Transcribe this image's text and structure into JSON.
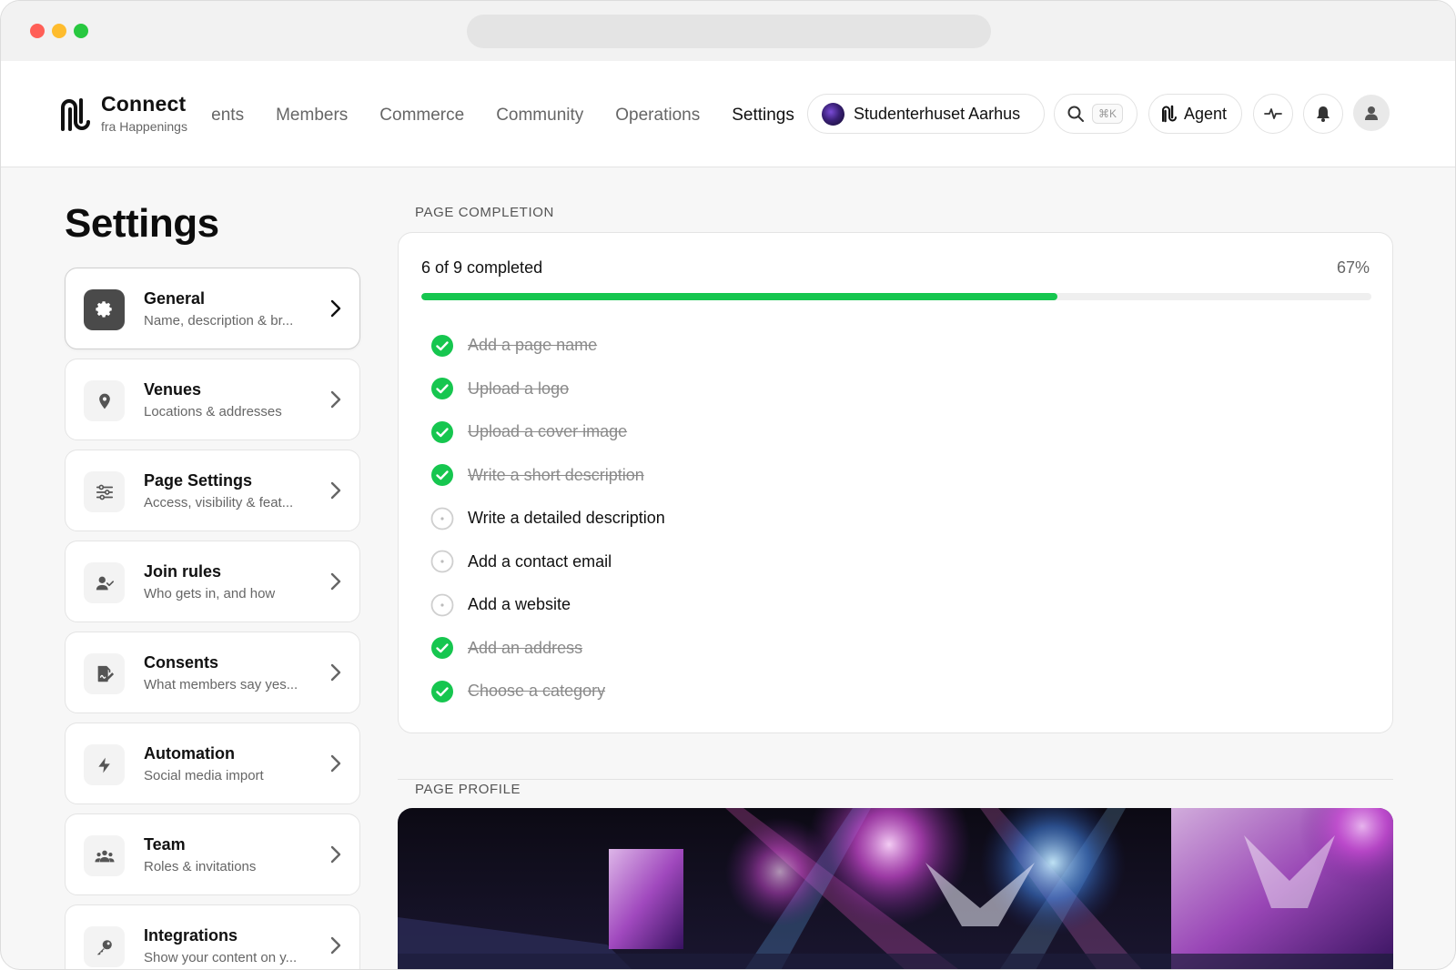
{
  "app": {
    "brand_title": "Connect",
    "brand_subtitle": "fra Happenings"
  },
  "nav": {
    "items": [
      {
        "label": "Events"
      },
      {
        "label": "Members"
      },
      {
        "label": "Commerce"
      },
      {
        "label": "Community"
      },
      {
        "label": "Operations"
      },
      {
        "label": "Settings"
      }
    ],
    "active_label": "Settings"
  },
  "header": {
    "org_name": "Studenterhuset Aarhus",
    "search_shortcut": "⌘K",
    "agent_label": "Agent",
    "icons": [
      "search-icon",
      "agent-logo-icon",
      "activity-icon",
      "bell-icon",
      "user-icon"
    ]
  },
  "settings": {
    "title": "Settings",
    "items": [
      {
        "title": "General",
        "subtitle": "Name, description & br...",
        "icon": "gear-icon",
        "active": true
      },
      {
        "title": "Venues",
        "subtitle": "Locations & addresses",
        "icon": "map-pin-icon"
      },
      {
        "title": "Page Settings",
        "subtitle": "Access, visibility & feat...",
        "icon": "sliders-icon"
      },
      {
        "title": "Join rules",
        "subtitle": "Who gets in, and how",
        "icon": "user-check-icon"
      },
      {
        "title": "Consents",
        "subtitle": "What members say yes...",
        "icon": "signature-icon"
      },
      {
        "title": "Automation",
        "subtitle": "Social media import",
        "icon": "bolt-icon"
      },
      {
        "title": "Team",
        "subtitle": "Roles & invitations",
        "icon": "team-icon"
      },
      {
        "title": "Integrations",
        "subtitle": "Show your content on y...",
        "icon": "key-icon"
      }
    ]
  },
  "completion": {
    "section_label": "PAGE COMPLETION",
    "count_text": "6 of 9 completed",
    "percent_text": "67%",
    "progress_fraction": 0.67,
    "items": [
      {
        "label": "Add a page name",
        "done": true
      },
      {
        "label": "Upload a logo",
        "done": true
      },
      {
        "label": "Upload a cover image",
        "done": true
      },
      {
        "label": "Write a short description",
        "done": true
      },
      {
        "label": "Write a detailed description",
        "done": false
      },
      {
        "label": "Add a contact email",
        "done": false
      },
      {
        "label": "Add a website",
        "done": false
      },
      {
        "label": "Add an address",
        "done": true
      },
      {
        "label": "Choose a category",
        "done": true
      }
    ],
    "colors": {
      "done": "#16c64f",
      "pending": "#cfcfcf"
    }
  },
  "profile": {
    "section_label": "PAGE PROFILE"
  }
}
